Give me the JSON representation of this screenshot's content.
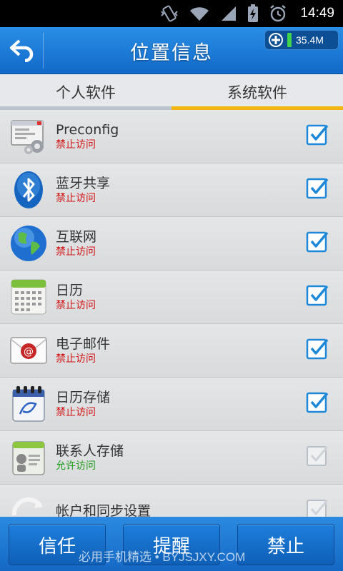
{
  "status_bar": {
    "time": "14:49"
  },
  "header": {
    "title": "位置信息",
    "memory": "35.4M"
  },
  "tabs": [
    {
      "label": "个人软件",
      "active": false
    },
    {
      "label": "系统软件",
      "active": true
    }
  ],
  "apps": [
    {
      "name": "Preconfig",
      "status": "禁止访问",
      "checked": true,
      "icon": "settings-window-icon"
    },
    {
      "name": "蓝牙共享",
      "status": "禁止访问",
      "checked": true,
      "icon": "bluetooth-icon"
    },
    {
      "name": "互联网",
      "status": "禁止访问",
      "checked": true,
      "icon": "globe-icon"
    },
    {
      "name": "日历",
      "status": "禁止访问",
      "checked": true,
      "icon": "calendar-icon"
    },
    {
      "name": "电子邮件",
      "status": "禁止访问",
      "checked": true,
      "icon": "email-icon"
    },
    {
      "name": "日历存储",
      "status": "禁止访问",
      "checked": true,
      "icon": "calendar-storage-icon"
    },
    {
      "name": "联系人存储",
      "status": "允许访问",
      "checked": false,
      "icon": "contacts-storage-icon"
    },
    {
      "name": "帐户和同步设置",
      "status": "",
      "checked": false,
      "icon": "sync-icon"
    }
  ],
  "bottom_buttons": {
    "trust": "信任",
    "remind": "提醒",
    "forbid": "禁止"
  },
  "watermark": "必用手机精选 • BYJSJXY.COM",
  "colors": {
    "header_blue": "#1a7ad6",
    "tab_accent": "#f2b613",
    "deny_red": "#d21414",
    "allow_green": "#1f9a1a",
    "check_blue": "#1e88d8"
  }
}
